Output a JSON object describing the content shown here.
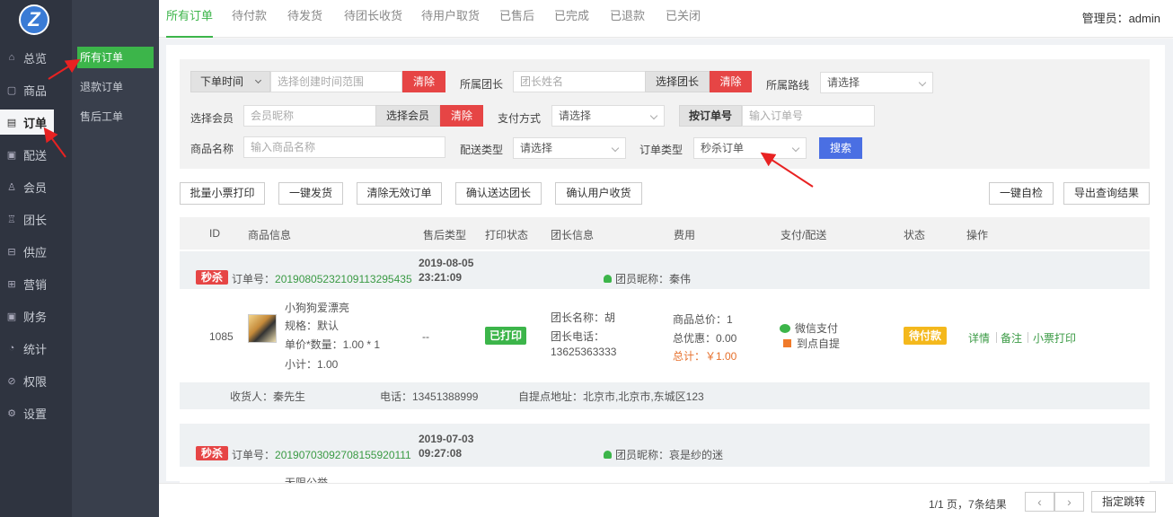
{
  "logo": {
    "letter": "Z"
  },
  "nav": [
    {
      "label": "总览",
      "icon": "home-icon"
    },
    {
      "label": "商品",
      "icon": "goods-icon"
    },
    {
      "label": "订单",
      "icon": "order-icon"
    },
    {
      "label": "配送",
      "icon": "delivery-icon"
    },
    {
      "label": "会员",
      "icon": "member-icon"
    },
    {
      "label": "团长",
      "icon": "leader-icon"
    },
    {
      "label": "供应",
      "icon": "supply-icon"
    },
    {
      "label": "营销",
      "icon": "gift-icon"
    },
    {
      "label": "财务",
      "icon": "finance-icon"
    },
    {
      "label": "统计",
      "icon": "stats-icon"
    },
    {
      "label": "权限",
      "icon": "permission-icon"
    },
    {
      "label": "设置",
      "icon": "settings-icon"
    }
  ],
  "subnav": [
    "所有订单",
    "退款订单",
    "售后工单"
  ],
  "tabs": [
    "所有订单",
    "待付款",
    "待发货",
    "待团长收货",
    "待用户取货",
    "已售后",
    "已完成",
    "已退款",
    "已关闭"
  ],
  "admin": "管理员：admin",
  "filter": {
    "time_select": "下单时间",
    "time_placeholder": "选择创建时间范围",
    "clear": "清除",
    "leader_label": "所属团长",
    "leader_placeholder": "团长姓名",
    "choose_leader": "选择团长",
    "route_label": "所属路线",
    "route_value": "请选择",
    "member_label": "选择会员",
    "member_placeholder": "会员昵称",
    "choose_member": "选择会员",
    "pay_label": "支付方式",
    "pay_value": "请选择",
    "order_no_btn": "按订单号",
    "order_no_placeholder": "输入订单号",
    "goods_label": "商品名称",
    "goods_placeholder": "输入商品名称",
    "delivery_label": "配送类型",
    "delivery_value": "请选择",
    "type_label": "订单类型",
    "type_value": "秒杀订单",
    "search": "搜索"
  },
  "actions": {
    "batch_print": "批量小票打印",
    "ship": "一键发货",
    "clear_invalid": "清除无效订单",
    "confirm_leader": "确认送达团长",
    "confirm_user": "确认用户收货",
    "self_check": "一键自检",
    "export": "导出查询结果"
  },
  "columns": [
    "ID",
    "商品信息",
    "售后类型",
    "打印状态",
    "团长信息",
    "费用",
    "支付/配送",
    "状态",
    "操作"
  ],
  "orders": [
    {
      "tag": "秒杀",
      "order_no_label": "订单号：",
      "order_no": "2019080523210911329543​5",
      "date": "2019-08-05",
      "time": "23:21:09",
      "member": "团员昵称：秦伟",
      "id": "1085",
      "goods_name": "小狗狗爱漂亮",
      "spec": "规格：默认",
      "price_qty": "单价*数量：1.00 * 1",
      "subtotal": "小计：1.00",
      "aftersale": "--",
      "print_status": "已打印",
      "leader_name": "团长名称：胡",
      "leader_phone_label": "团长电话：",
      "leader_phone": "13625363333",
      "goods_total": "商品总价：1",
      "discount": "总优惠：0.00",
      "total": "总计：￥1.00",
      "pay": "微信支付",
      "delivery": "到点自提",
      "status": "待付款",
      "op_detail": "详情",
      "op_note": "备注",
      "op_print": "小票打印",
      "receiver": "收货人：秦先生",
      "phone": "电话：13451388999",
      "address": "自提点地址：北京市,北京市,东城区123"
    },
    {
      "tag": "秒杀",
      "order_no_label": "订单号：",
      "order_no": "20190703092708155920111",
      "date": "2019-07-03",
      "time": "09:27:08",
      "member": "团员昵称：哀是纱的迷",
      "goods_name": "无限公举"
    }
  ],
  "pagination": {
    "info": "1/1 页，7条结果",
    "prev": "‹",
    "next": "›",
    "jump": "指定跳转"
  },
  "colors": {
    "sidebar": "#2f3440",
    "subbar": "#393f4c",
    "accent_green": "#3cb54a",
    "danger_red": "#e64545",
    "primary_blue": "#4a6fe3",
    "warning_yellow": "#f4b81c",
    "annotation_arrow": "#e82222"
  }
}
